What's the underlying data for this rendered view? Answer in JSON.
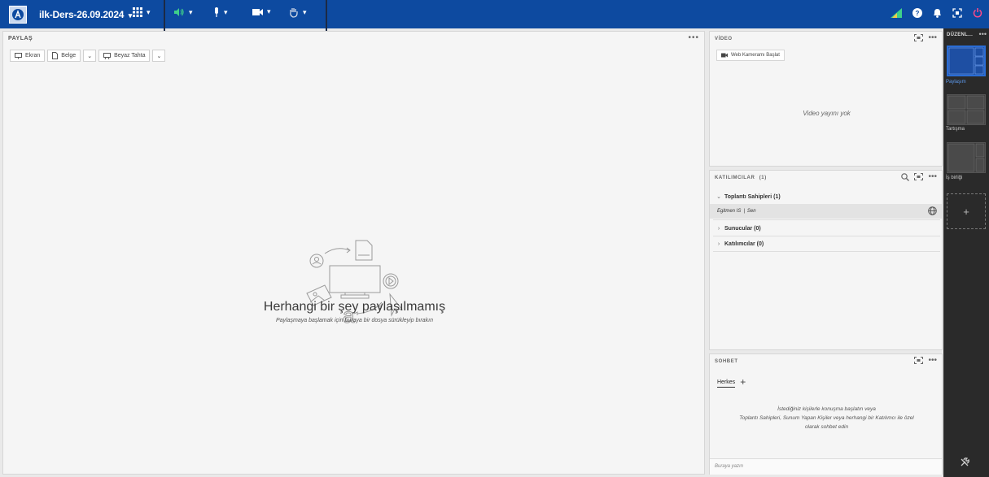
{
  "topbar": {
    "title": "ilk-Ders-26.09.2024",
    "icons": [
      "apps-icon",
      "speaker-icon",
      "microphone-icon",
      "camera-icon",
      "raise-hand-icon",
      "connection-status-icon",
      "help-icon",
      "notifications-icon",
      "fullscreen-icon",
      "power-icon"
    ],
    "accent": "#0d4aa0",
    "speaker_color": "#3fd08a",
    "power_color": "#ff4a8a"
  },
  "share_pod": {
    "title": "PAYLAŞ",
    "menu": "•••",
    "toolbar": {
      "screen": "Ekran",
      "document": "Belge",
      "whiteboard": "Beyaz Tahta"
    },
    "empty_title": "Herhangi bir şey paylaşılmamış",
    "empty_subtitle": "Paylaşmaya başlamak için buraya bir dosya sürükleyip bırakın"
  },
  "video_pod": {
    "title": "VİDEO",
    "menu": "•••",
    "start_webcam": "Web Kameramı Başlat",
    "no_video": "Video yayını yok"
  },
  "people_pod": {
    "title": "KATILIMCILAR",
    "count": "(1)",
    "menu": "•••",
    "hosts_label": "Toplantı Sahipleri (1)",
    "me_name": "Egitmen IS",
    "me_tag": "Sen",
    "presenters_label": "Sunucular (0)",
    "participants_label": "Katılımcılar (0)"
  },
  "chat_pod": {
    "title": "SOHBET",
    "menu": "•••",
    "tab": "Herkes",
    "add_tab": "+",
    "help_line1": "İstediğiniz kişilerle konuşma başlatın veya",
    "help_line2": "Toplantı Sahipleri, Sunum Yapan Kişiler veya herhangi bir Katılımcı ile özel",
    "help_line3": "olarak sohbet edin",
    "input_placeholder": "Buraya yazın"
  },
  "layouts": {
    "title": "DÜZENL...",
    "menu": "•••",
    "items": [
      {
        "label": "Paylaşım",
        "active": true
      },
      {
        "label": "Tartışma",
        "active": false
      },
      {
        "label": "İş birliği",
        "active": false
      }
    ],
    "add": "+"
  }
}
